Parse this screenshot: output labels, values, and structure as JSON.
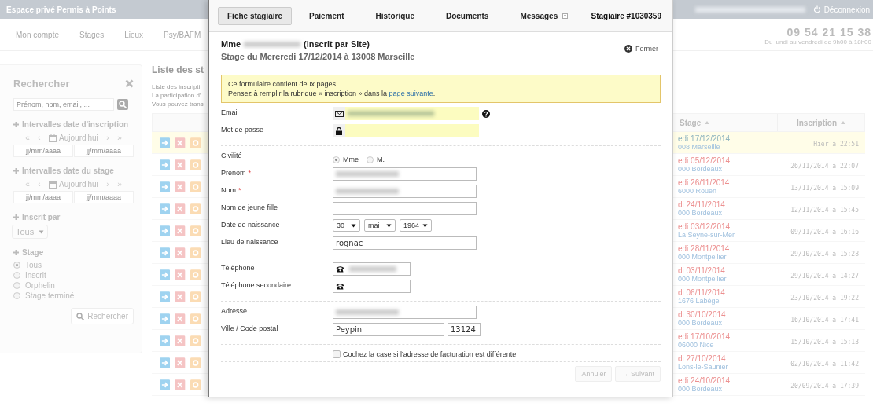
{
  "topbar": {
    "title": "Espace privé Permis à Points",
    "user_redacted": true,
    "logout": "Déconnexion"
  },
  "nav": {
    "items": [
      {
        "label": "Mon compte"
      },
      {
        "label": "Stages"
      },
      {
        "label": "Lieux"
      },
      {
        "label": "Psy/BAFM"
      }
    ],
    "phone": "09 54 21 15 38",
    "hours": "Du lundi au vendredi de 9h00 à 18h00"
  },
  "search_panel": {
    "title": "Rechercher",
    "search": {
      "placeholder": "Prénom, nom, email, ..."
    },
    "filters": [
      {
        "kind": "dates",
        "title": "Intervalles date d'inscription",
        "nav": [
          "«",
          "‹",
          "Aujourd'hui",
          "›",
          "»"
        ],
        "from": {
          "placeholder": "jj/mm/aaaa"
        },
        "to": {
          "placeholder": "jj/mm/aaaa"
        }
      },
      {
        "kind": "dates",
        "title": "Intervalles date du stage",
        "nav": [
          "«",
          "‹",
          "Aujourd'hui",
          "›",
          "»"
        ],
        "from": {
          "placeholder": "jj/mm/aaaa"
        },
        "to": {
          "placeholder": "jj/mm/aaaa"
        }
      },
      {
        "kind": "select",
        "title": "Inscrit par",
        "value": "Tous"
      },
      {
        "kind": "radios",
        "title": "Stage",
        "options": [
          {
            "label": "Tous",
            "selected": true
          },
          {
            "label": "Inscrit",
            "selected": false
          },
          {
            "label": "Orphelin",
            "selected": false
          },
          {
            "label": "Stage terminé",
            "selected": false
          }
        ]
      }
    ],
    "button": "Rechercher"
  },
  "list": {
    "title": "Liste des st",
    "intro": [
      "Liste des inscripti",
      "La participation d'",
      "Vous pouvez trans"
    ],
    "columns": [
      "Stage",
      "Inscription"
    ],
    "rows": [
      {
        "selected": true,
        "date": "edi 17/12/2014",
        "color": "#8fb4bf",
        "place": "008 Marseille",
        "inscription": "Hier à 22:51"
      },
      {
        "selected": false,
        "date": "edi 05/12/2014",
        "color": "#ec9090",
        "place": "000 Bordeaux",
        "inscription": "26/11/2014 à 22:07"
      },
      {
        "selected": false,
        "date": "edi 26/11/2014",
        "color": "#ec9090",
        "place": "6000 Rouen",
        "inscription": "13/11/2014 à 15:09"
      },
      {
        "selected": false,
        "date": "di 24/11/2014",
        "color": "#ec9090",
        "place": "000 Bordeaux",
        "inscription": "12/11/2014 à 15:45"
      },
      {
        "selected": false,
        "date": "edi 03/12/2014",
        "color": "#ec9090",
        "place": "La Seyne-sur-Mer",
        "inscription": "09/11/2014 à 16:16"
      },
      {
        "selected": false,
        "date": "edi 28/11/2014",
        "color": "#ec9090",
        "place": "000 Montpellier",
        "inscription": "29/10/2014 à 15:28"
      },
      {
        "selected": false,
        "date": "di 03/11/2014",
        "color": "#ec9090",
        "place": "000 Montpellier",
        "inscription": "29/10/2014 à 14:27"
      },
      {
        "selected": false,
        "date": "di 06/11/2014",
        "color": "#ec9090",
        "place": "1676 Labège",
        "inscription": "23/10/2014 à 19:22"
      },
      {
        "selected": false,
        "date": "di 30/10/2014",
        "color": "#ec9090",
        "place": "000 Bordeaux",
        "inscription": "16/10/2014 à 17:41"
      },
      {
        "selected": false,
        "date": "edi 17/10/2014",
        "color": "#ec9090",
        "place": "06000 Nice",
        "inscription": "15/10/2014 à 15:13"
      },
      {
        "selected": false,
        "date": "di 27/10/2014",
        "color": "#ec9090",
        "place": "Lons-le-Saunier",
        "inscription": "02/10/2014 à 11:42"
      },
      {
        "selected": false,
        "date": "edi 24/10/2014",
        "color": "#ec9090",
        "place": "000 Bordeaux",
        "inscription": "20/09/2014 à 17:39"
      }
    ]
  },
  "modal": {
    "tabs": [
      {
        "label": "Fiche stagiaire",
        "selected": true,
        "dropdown": false
      },
      {
        "label": "Paiement",
        "selected": false,
        "dropdown": false
      },
      {
        "label": "Historique",
        "selected": false,
        "dropdown": false
      },
      {
        "label": "Documents",
        "selected": false,
        "dropdown": false
      },
      {
        "label": "Messages",
        "selected": false,
        "dropdown": true
      }
    ],
    "trainee_id": "Stagiaire #1030359",
    "civility": "Mme",
    "name_redacted": true,
    "source": "(inscrit par Site)",
    "subtitle": "Stage du Mercredi 17/12/2014 à 13008 Marseille",
    "close": "Fermer",
    "notice": {
      "line1": "Ce formulaire contient deux pages.",
      "line2_before": "Pensez à remplir la rubrique « inscription » dans la ",
      "link": "page suivante",
      "line2_after": "."
    },
    "sections": [
      [
        {
          "kind": "email",
          "label": "Email",
          "redacted": true,
          "help": true
        },
        {
          "kind": "password",
          "label": "Mot de passe"
        }
      ],
      [
        {
          "kind": "radio",
          "label": "Civilité",
          "options": [
            {
              "label": "Mme",
              "selected": true
            },
            {
              "label": "M.",
              "selected": false
            }
          ]
        },
        {
          "kind": "text",
          "label": "Prénom",
          "required_mark": "*",
          "redacted": true
        },
        {
          "kind": "text",
          "label": "Nom",
          "required_mark": "*",
          "redacted": true
        },
        {
          "kind": "text",
          "label": "Nom de jeune fille"
        },
        {
          "kind": "date",
          "label": "Date de naissance",
          "selects": [
            "30",
            "mai",
            "1964"
          ]
        },
        {
          "kind": "text",
          "label": "Lieu de naissance",
          "value": "rognac"
        }
      ],
      [
        {
          "kind": "phone",
          "label": "Téléphone",
          "redacted": true
        },
        {
          "kind": "phone",
          "label": "Téléphone secondaire"
        }
      ],
      [
        {
          "kind": "text",
          "label": "Adresse",
          "redacted": true
        },
        {
          "kind": "city",
          "label": "Ville / Code postal",
          "city": "Peypin",
          "postcode": "13124"
        }
      ]
    ],
    "billing_checkbox": {
      "label": "Cochez la case si l'adresse de facturation est différente",
      "checked": false
    },
    "buttons": [
      {
        "label": "Annuler",
        "disabled": true
      },
      {
        "label": "→ Suivant",
        "disabled": true
      }
    ]
  }
}
